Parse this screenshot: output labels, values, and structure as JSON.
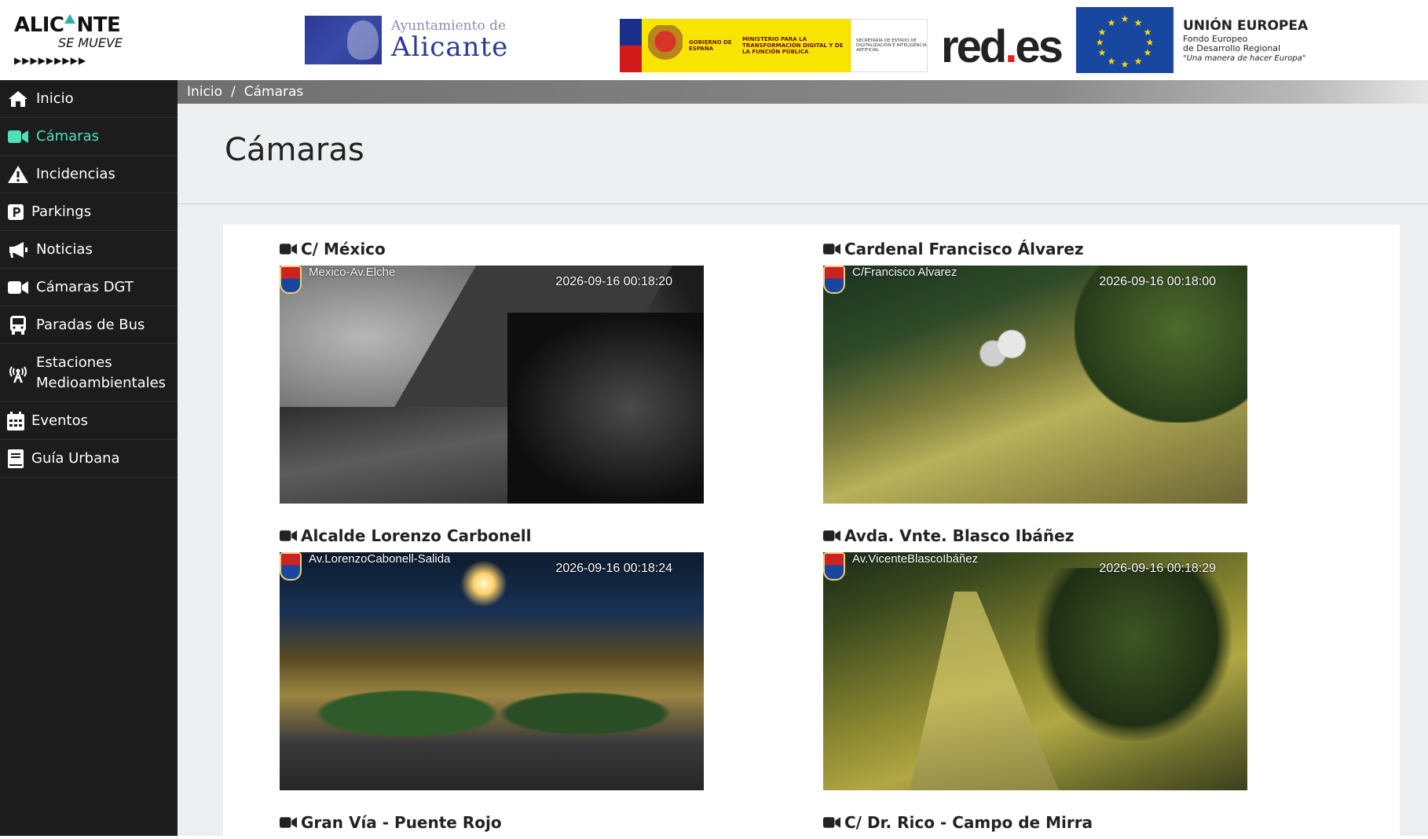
{
  "header": {
    "alicante_logo": {
      "line1_a": "ALIC",
      "line1_b": "NTE",
      "line2": "SE MUEVE",
      "arrows": "▶▶▶▶▶▶▶▶▶"
    },
    "ayuntamiento": {
      "line1": "Ayuntamiento de",
      "line2": "Alicante"
    },
    "gobierno": {
      "gobierno": "GOBIERNO DE ESPAÑA",
      "ministerio": "MINISTERIO PARA LA TRANSFORMACIÓN DIGITAL Y DE LA FUNCIÓN PÚBLICA",
      "secretaria": "SECRETARÍA DE ESTADO DE DIGITALIZACIÓN E INTELIGENCIA ARTIFICIAL"
    },
    "redes": {
      "a": "red",
      "dot": ".",
      "b": "es"
    },
    "eu": {
      "title": "UNIÓN EUROPEA",
      "line1": "Fondo Europeo",
      "line2": "de Desarrollo Regional",
      "line3": "\"Una manera de hacer Europa\""
    }
  },
  "sidebar": {
    "items": [
      {
        "label": "Inicio",
        "icon": "home-icon"
      },
      {
        "label": "Cámaras",
        "icon": "video-camera-icon",
        "active": true
      },
      {
        "label": "Incidencias",
        "icon": "warning-icon"
      },
      {
        "label": "Parkings",
        "icon": "parking-icon"
      },
      {
        "label": "Noticias",
        "icon": "megaphone-icon"
      },
      {
        "label": "Cámaras DGT",
        "icon": "video-camera-icon"
      },
      {
        "label": "Paradas de Bus",
        "icon": "bus-icon"
      },
      {
        "label": "Estaciones",
        "label2": "Medioambientales",
        "icon": "broadcast-tower-icon"
      },
      {
        "label": "Eventos",
        "icon": "calendar-icon"
      },
      {
        "label": "Guía Urbana",
        "icon": "book-icon"
      }
    ],
    "active_color": "#4fe0b8"
  },
  "breadcrumb": {
    "home": "Inicio",
    "separator": "/",
    "current": "Cámaras"
  },
  "page": {
    "title": "Cámaras"
  },
  "cameras": [
    {
      "title": "C/ México",
      "overlay_name": "Mexico-Av.Elche",
      "timestamp": "2026-09-16 00:18:20"
    },
    {
      "title": "Cardenal Francisco Álvarez",
      "overlay_name": "C/Francisco Alvarez",
      "timestamp": "2026-09-16 00:18:00"
    },
    {
      "title": "Alcalde Lorenzo Carbonell",
      "overlay_name": "Av.LorenzoCabonell-Salida",
      "timestamp": "2026-09-16 00:18:24"
    },
    {
      "title": "Avda. Vnte. Blasco Ibáñez",
      "overlay_name": "Av.VicenteBlascoIbáñez",
      "timestamp": "2026-09-16 00:18:29"
    },
    {
      "title": "Gran Vía - Puente Rojo"
    },
    {
      "title": "C/ Dr. Rico - Campo de Mirra"
    }
  ]
}
